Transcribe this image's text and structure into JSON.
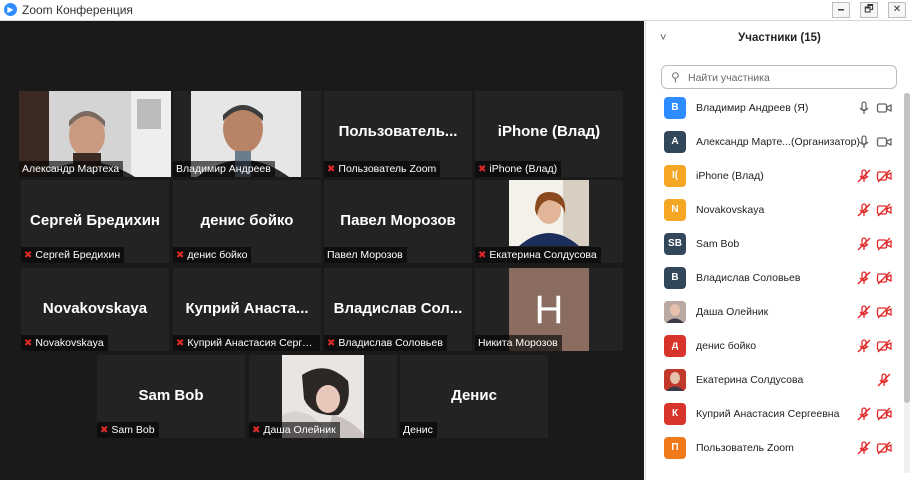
{
  "window": {
    "title": "Zoom Конференция",
    "app_icon": "zoom-icon",
    "minimize": "🗕",
    "restore": "🗗",
    "close": "✕"
  },
  "colors": {
    "active_speaker": "#c7e55a",
    "muted": "#e02828",
    "accent": "#2D8CFF"
  },
  "tiles": [
    {
      "display": "",
      "label": "Александр Мартеха",
      "muted": false
    },
    {
      "display": "",
      "label": "Владимир Андреев",
      "muted": false
    },
    {
      "display": "Пользователь...",
      "label": "Пользователь Zoom",
      "muted": true
    },
    {
      "display": "iPhone (Влад)",
      "label": "iPhone (Влад)",
      "muted": true
    },
    {
      "display": "Сергей Бредихин",
      "label": "Сергей Бредихин",
      "muted": true
    },
    {
      "display": "денис бойко",
      "label": "денис бойко",
      "muted": true
    },
    {
      "display": "Павел Морозов",
      "label": "Павел Морозов",
      "muted": false
    },
    {
      "display": "",
      "label": "Екатерина Солдусова",
      "muted": true
    },
    {
      "display": "Novakovskaya",
      "label": "Novakovskaya",
      "muted": true
    },
    {
      "display": "Куприй Анаста...",
      "label": "Куприй Анастасия Серге...",
      "muted": true
    },
    {
      "display": "Владислав Сол...",
      "label": "Владислав Соловьев",
      "muted": true
    },
    {
      "display": "H",
      "label": "Никита Морозов",
      "muted": false
    },
    {
      "display": "Sam Bob",
      "label": "Sam Bob",
      "muted": true
    },
    {
      "display": "",
      "label": "Даша Олейник",
      "muted": true
    },
    {
      "display": "Денис",
      "label": "Денис",
      "muted": false
    }
  ],
  "panel": {
    "title": "Участники (15)",
    "collapse_icon": "˅",
    "search_icon": "⚲",
    "search_placeholder": "Найти участника",
    "participants": [
      {
        "initials": "В",
        "color": "#2D8CFF",
        "name": "Владимир Андреев (Я)",
        "mic": "on",
        "cam": "on"
      },
      {
        "initials": "А",
        "color": "#33475b",
        "name": "Александр Марте...(Организатор)",
        "mic": "on",
        "cam": "on"
      },
      {
        "initials": "I(",
        "color": "#f5a623",
        "name": "iPhone (Влад)",
        "mic": "off",
        "cam": "off"
      },
      {
        "initials": "N",
        "color": "#f5a623",
        "name": "Novakovskaya",
        "mic": "off",
        "cam": "off"
      },
      {
        "initials": "SB",
        "color": "#33475b",
        "name": "Sam Bob",
        "mic": "off",
        "cam": "off"
      },
      {
        "initials": "В",
        "color": "#33475b",
        "name": "Владислав Соловьев",
        "mic": "off",
        "cam": "off"
      },
      {
        "initials": "",
        "color": "#b9a9a0",
        "name": "Даша Олейник",
        "mic": "off",
        "cam": "off"
      },
      {
        "initials": "д",
        "color": "#d9342b",
        "name": "денис бойко",
        "mic": "off",
        "cam": "off"
      },
      {
        "initials": "",
        "color": "#c0392b",
        "name": "Екатерина Солдусова",
        "mic": "off",
        "cam": "none"
      },
      {
        "initials": "К",
        "color": "#d9342b",
        "name": "Куприй Анастасия Сергеевна",
        "mic": "off",
        "cam": "off"
      },
      {
        "initials": "П",
        "color": "#f07a1a",
        "name": "Пользователь Zoom",
        "mic": "off",
        "cam": "off"
      }
    ]
  }
}
